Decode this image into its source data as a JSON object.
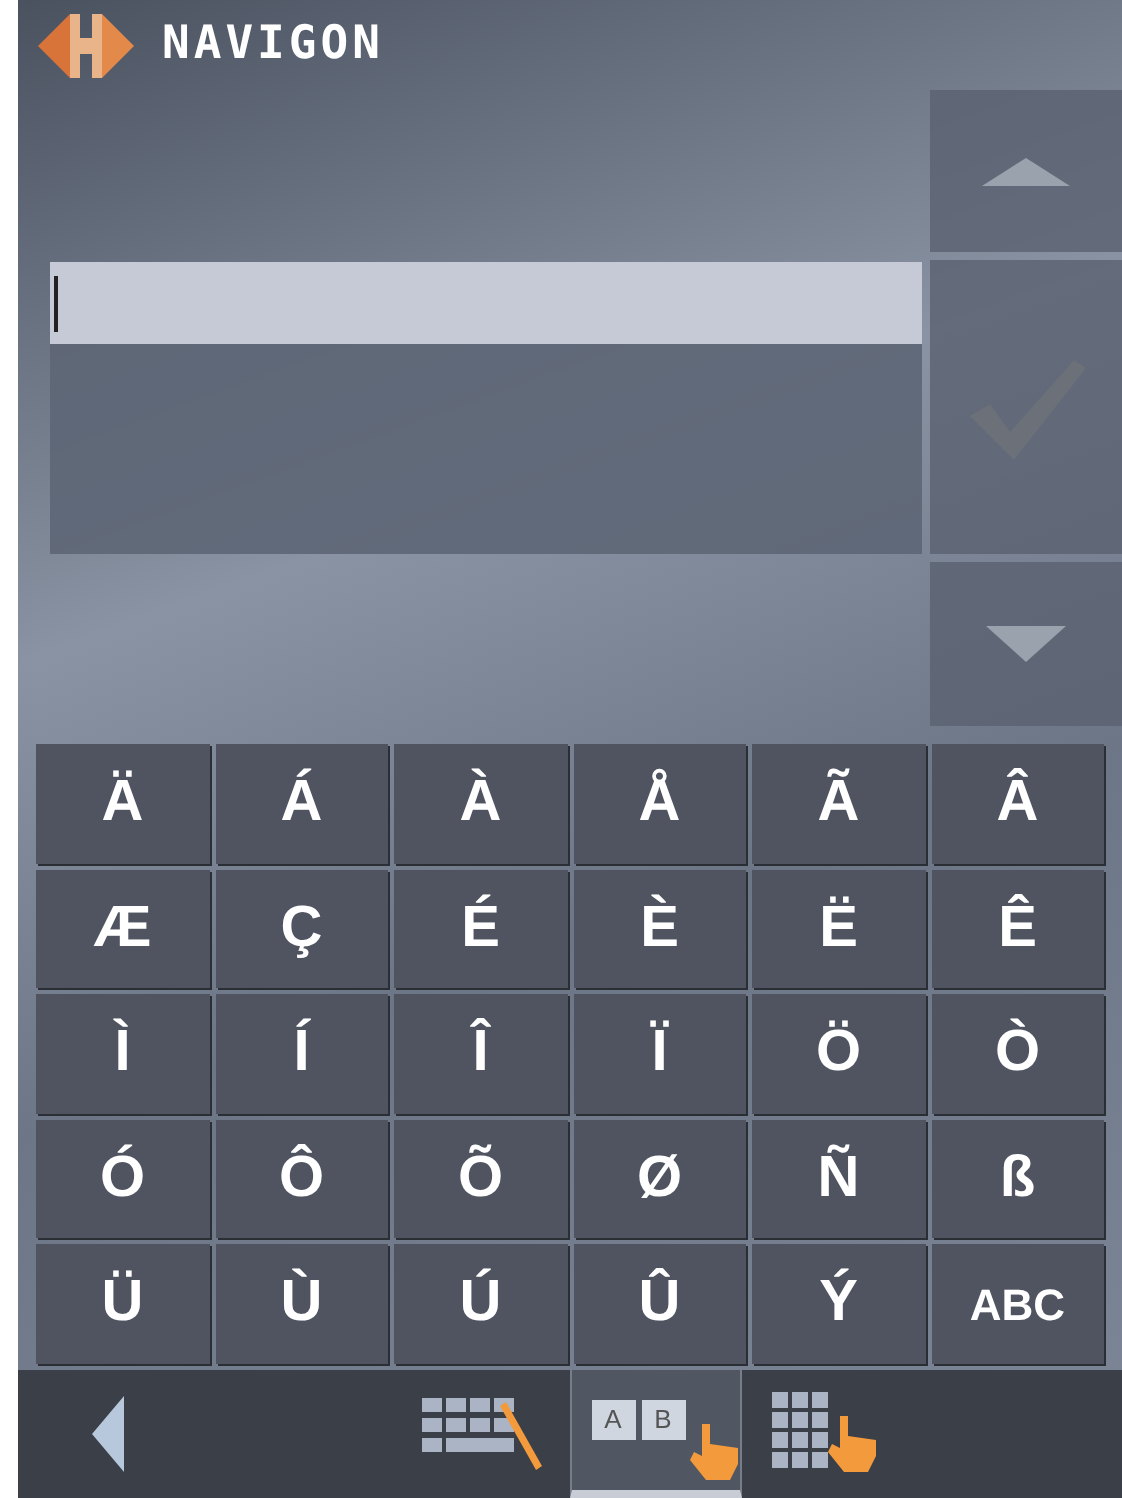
{
  "header": {
    "brand": "NAVIGON"
  },
  "input_field": {
    "focused": true
  },
  "side_buttons": [
    {
      "kind": "up"
    },
    {
      "kind": "ok"
    },
    {
      "kind": "down"
    }
  ],
  "keys": [
    {
      "kind": "char",
      "label": "Ä"
    },
    {
      "kind": "char",
      "label": "Á"
    },
    {
      "kind": "char",
      "label": "À"
    },
    {
      "kind": "char",
      "label": "Å"
    },
    {
      "kind": "char",
      "label": "Ã"
    },
    {
      "kind": "char",
      "label": "Â"
    },
    {
      "kind": "char",
      "label": "Æ"
    },
    {
      "kind": "char",
      "label": "Ç"
    },
    {
      "kind": "char",
      "label": "É"
    },
    {
      "kind": "char",
      "label": "È"
    },
    {
      "kind": "char",
      "label": "Ë"
    },
    {
      "kind": "char",
      "label": "Ê"
    },
    {
      "kind": "char",
      "label": "Ì"
    },
    {
      "kind": "char",
      "label": "Í"
    },
    {
      "kind": "char",
      "label": "Î"
    },
    {
      "kind": "char",
      "label": "Ï"
    },
    {
      "kind": "char",
      "label": "Ö"
    },
    {
      "kind": "char",
      "label": "Ò"
    },
    {
      "kind": "char",
      "label": "Ó"
    },
    {
      "kind": "char",
      "label": "Ô"
    },
    {
      "kind": "char",
      "label": "Õ"
    },
    {
      "kind": "char",
      "label": "Ø"
    },
    {
      "kind": "char",
      "label": "Ñ"
    },
    {
      "kind": "char",
      "label": "ß"
    },
    {
      "kind": "char",
      "label": "Ü"
    },
    {
      "kind": "char",
      "label": "Ù"
    },
    {
      "kind": "char",
      "label": "Ú"
    },
    {
      "kind": "char",
      "label": "Û"
    },
    {
      "kind": "char",
      "label": "Ý"
    },
    {
      "kind": "mode",
      "label": "ABC"
    }
  ],
  "bottom_bar": {
    "modes": [
      {
        "kind": "keyboard",
        "selected": false
      },
      {
        "kind": "letters",
        "selected": true,
        "letters": [
          "A",
          "B"
        ]
      },
      {
        "kind": "keypad",
        "selected": false
      }
    ]
  }
}
